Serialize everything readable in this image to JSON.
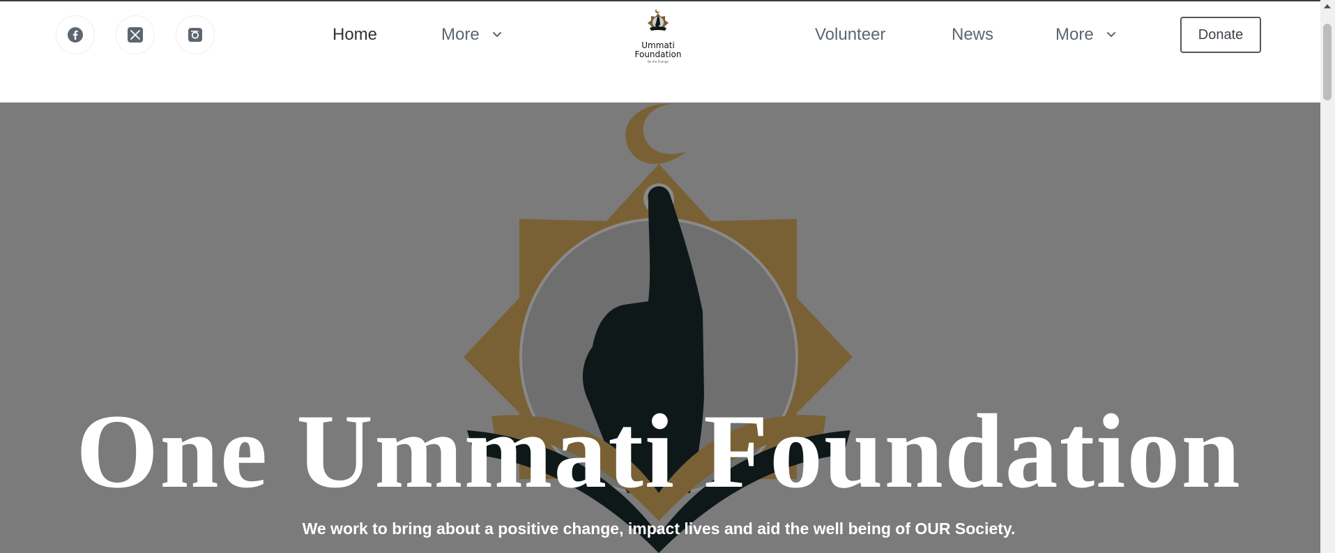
{
  "header": {
    "social": [
      {
        "icon": "facebook-icon"
      },
      {
        "icon": "x-twitter-icon"
      },
      {
        "icon": "instagram-icon"
      }
    ],
    "nav_left": [
      {
        "label": "Home",
        "active": true
      },
      {
        "label": "More",
        "dropdown": true
      }
    ],
    "logo": {
      "name_line1": "Ummati",
      "name_line2": "Foundation",
      "tagline": "Be the Change"
    },
    "nav_right": [
      {
        "label": "Volunteer"
      },
      {
        "label": "News"
      },
      {
        "label": "More",
        "dropdown": true
      }
    ],
    "donate_label": "Donate"
  },
  "hero": {
    "title": "One Ummati Foundation",
    "subtitle": "We work to bring about a positive change, impact lives and aid the well being of OUR Society."
  },
  "colors": {
    "hero_bg": "#7b7b7b",
    "emblem_gold": "#7a6135",
    "emblem_dark": "#0e1819",
    "nav_text": "#5d6670",
    "nav_active": "#2d3339"
  }
}
